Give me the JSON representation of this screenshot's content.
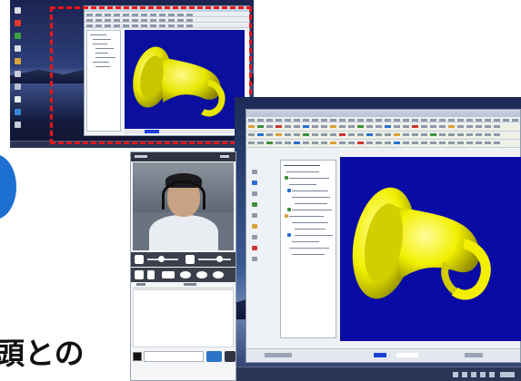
{
  "caption": {
    "text": "頭との"
  },
  "thumbnail": {
    "selection_color": "#e8141a",
    "viewport_color": "#0a0f9e",
    "model_color": "#e8e600"
  },
  "big_window": {
    "viewport_color": "#0a0aa5",
    "model_color": "#f2f000"
  },
  "chat": {
    "send_button_color": "#2b73c9",
    "accent_circle_color": "#1d6fd1"
  },
  "icons": [
    "horn-3d-model-icon",
    "webcam-video-icon",
    "volume-icon",
    "camera-icon",
    "send-icon",
    "bell-icon"
  ]
}
